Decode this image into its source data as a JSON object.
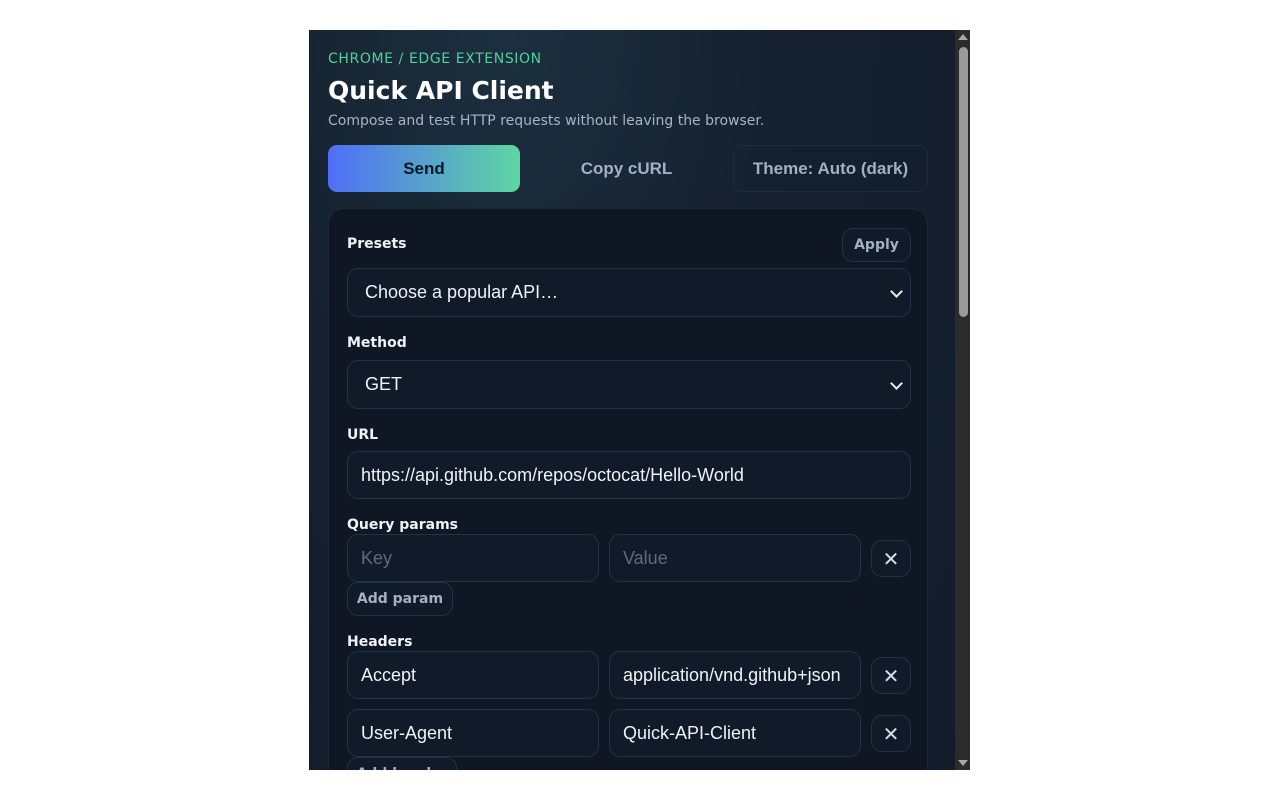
{
  "header": {
    "eyebrow": "CHROME / EDGE EXTENSION",
    "title": "Quick API Client",
    "subtitle": "Compose and test HTTP requests without leaving the browser."
  },
  "toolbar": {
    "send_label": "Send",
    "copy_curl_label": "Copy cURL",
    "theme_label": "Theme: Auto (dark)"
  },
  "presets": {
    "label": "Presets",
    "apply_label": "Apply",
    "selected": "Choose a popular API…"
  },
  "method": {
    "label": "Method",
    "selected": "GET"
  },
  "url": {
    "label": "URL",
    "value": "https://api.github.com/repos/octocat/Hello-World"
  },
  "query_params": {
    "label": "Query params",
    "key_placeholder": "Key",
    "value_placeholder": "Value",
    "add_label": "Add param"
  },
  "headers": {
    "label": "Headers",
    "rows": [
      {
        "key": "Accept",
        "value": "application/vnd.github+json"
      },
      {
        "key": "User-Agent",
        "value": "Quick-API-Client"
      }
    ],
    "add_label": "Add header"
  },
  "colors": {
    "accent_start": "#4f6ef7",
    "accent_end": "#5ed6a2",
    "eyebrow": "#4fd19c",
    "background": "#131c2b"
  }
}
